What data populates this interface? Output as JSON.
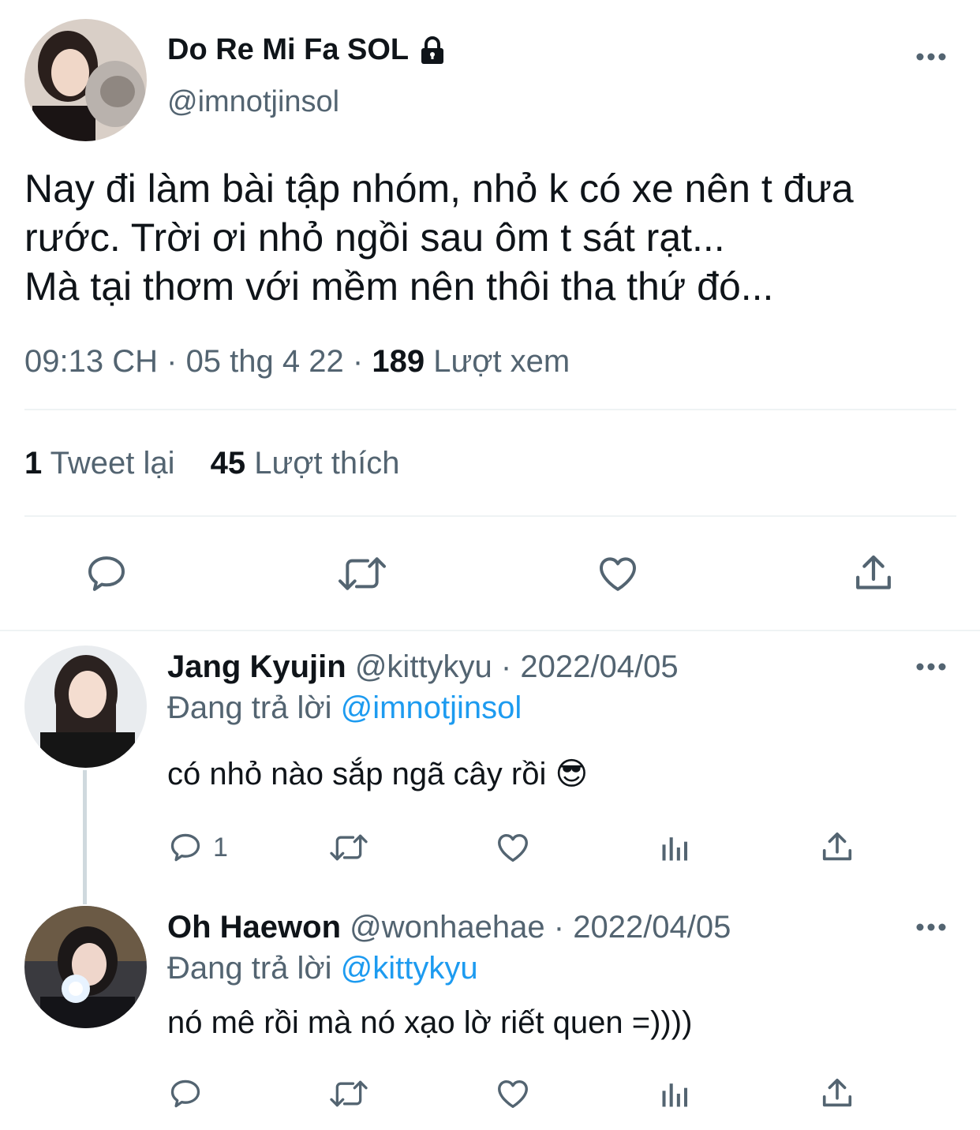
{
  "main_tweet": {
    "display_name": "Do Re Mi Fa SOL",
    "handle": "@imnotjinsol",
    "text": "Nay đi làm bài tập nhóm, nhỏ k có xe nên t đưa\nrước. Trời ơi nhỏ ngồi sau ôm t sát rạt...\nMà tại thơm với mềm nên thôi tha thứ đó...",
    "time": "09:13 CH",
    "sep1": "·",
    "date": "05 thg 4 22",
    "sep2": "·",
    "views_count": "189",
    "views_label": "Lượt xem",
    "retweets_count": "1",
    "retweets_label": "Tweet lại",
    "likes_count": "45",
    "likes_label": "Lượt thích",
    "icons": [
      "reply-icon",
      "retweet-icon",
      "like-icon",
      "share-icon"
    ]
  },
  "replies": [
    {
      "display_name": "Jang Kyujin",
      "handle": "@kittykyu",
      "sep": "·",
      "date": "2022/04/05",
      "replying_label": "Đang trả lời",
      "replying_to": "@imnotjinsol",
      "text": "có nhỏ nào sắp ngã cây rồi 😎",
      "reply_count": "1"
    },
    {
      "display_name": "Oh Haewon",
      "handle": "@wonhaehae",
      "sep": "·",
      "date": "2022/04/05",
      "replying_label": "Đang trả lời",
      "replying_to": "@kittykyu",
      "text": "nó mê rồi mà nó xạo lờ riết quen =))))",
      "reply_count": ""
    }
  ],
  "colors": {
    "text": "#0f1419",
    "secondary": "#536471",
    "link": "#1d9bf0",
    "divider": "#eff3f4",
    "thread_line": "#cfd9de"
  }
}
